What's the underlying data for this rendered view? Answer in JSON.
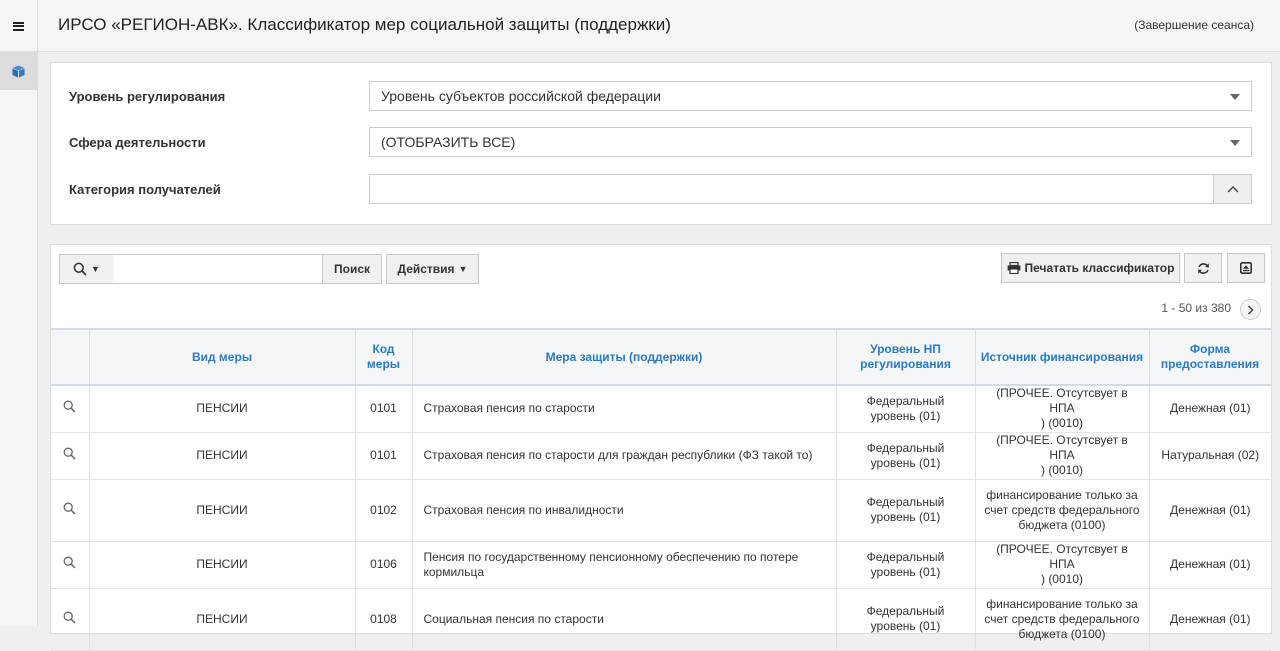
{
  "header": {
    "title": "ИРСО «РЕГИОН-АВК». Классификатор мер социальной защиты (поддержки)",
    "logout_label": "(Завершение сеанса)"
  },
  "filters": {
    "level_label": "Уровень регулирования",
    "level_value": "Уровень субъектов российской федерации",
    "sphere_label": "Сфера деятельности",
    "sphere_value": "(ОТОБРАЗИТЬ ВСЕ)",
    "category_label": "Категория получателей",
    "category_value": ""
  },
  "toolbar": {
    "search_button": "Поиск",
    "actions_button": "Действия",
    "print_button": "Печатать классификатор",
    "search_value": ""
  },
  "pager": {
    "text": "1 - 50 из 380"
  },
  "table": {
    "headers": {
      "kind": "Вид меры",
      "code_1": "Код",
      "code_2": "меры",
      "measure": "Мера защиты (поддержки)",
      "level_1": "Уровень НП",
      "level_2": "регулирования",
      "source": "Источник финансирования",
      "form_1": "Форма",
      "form_2": "предоставления"
    },
    "rows": [
      {
        "kind": "ПЕНСИИ",
        "code": "0101",
        "measure": "Страховая пенсия по старости",
        "level_1": "Федеральный",
        "level_2": "уровень (01)",
        "source_1": "(ПРОЧЕЕ. Отсутсвует в НПА",
        "source_2": ") (0010)",
        "source_3": "",
        "form": "Денежная (01)"
      },
      {
        "kind": "ПЕНСИИ",
        "code": "0101",
        "measure": "Страховая пенсия по старости для граждан республики (ФЗ такой то)",
        "level_1": "Федеральный",
        "level_2": "уровень (01)",
        "source_1": "(ПРОЧЕЕ. Отсутсвует в НПА",
        "source_2": ") (0010)",
        "source_3": "",
        "form": "Натуральная (02)"
      },
      {
        "kind": "ПЕНСИИ",
        "code": "0102",
        "measure": "Страховая пенсия по инвалидности",
        "level_1": "Федеральный",
        "level_2": "уровень (01)",
        "source_1": "финансирование только за",
        "source_2": "счет средств федерального",
        "source_3": "бюджета (0100)",
        "form": "Денежная (01)"
      },
      {
        "kind": "ПЕНСИИ",
        "code": "0106",
        "measure": "Пенсия по государственному пенсионному обеспечению по потере кормильца",
        "level_1": "Федеральный",
        "level_2": "уровень (01)",
        "source_1": "(ПРОЧЕЕ. Отсутсвует в НПА",
        "source_2": ") (0010)",
        "source_3": "",
        "form": "Денежная (01)"
      },
      {
        "kind": "ПЕНСИИ",
        "code": "0108",
        "measure": "Социальная пенсия по старости",
        "level_1": "Федеральный",
        "level_2": "уровень (01)",
        "source_1": "финансирование только за",
        "source_2": "счет средств федерального",
        "source_3": "бюджета (0100)",
        "form": "Денежная (01)"
      }
    ]
  }
}
